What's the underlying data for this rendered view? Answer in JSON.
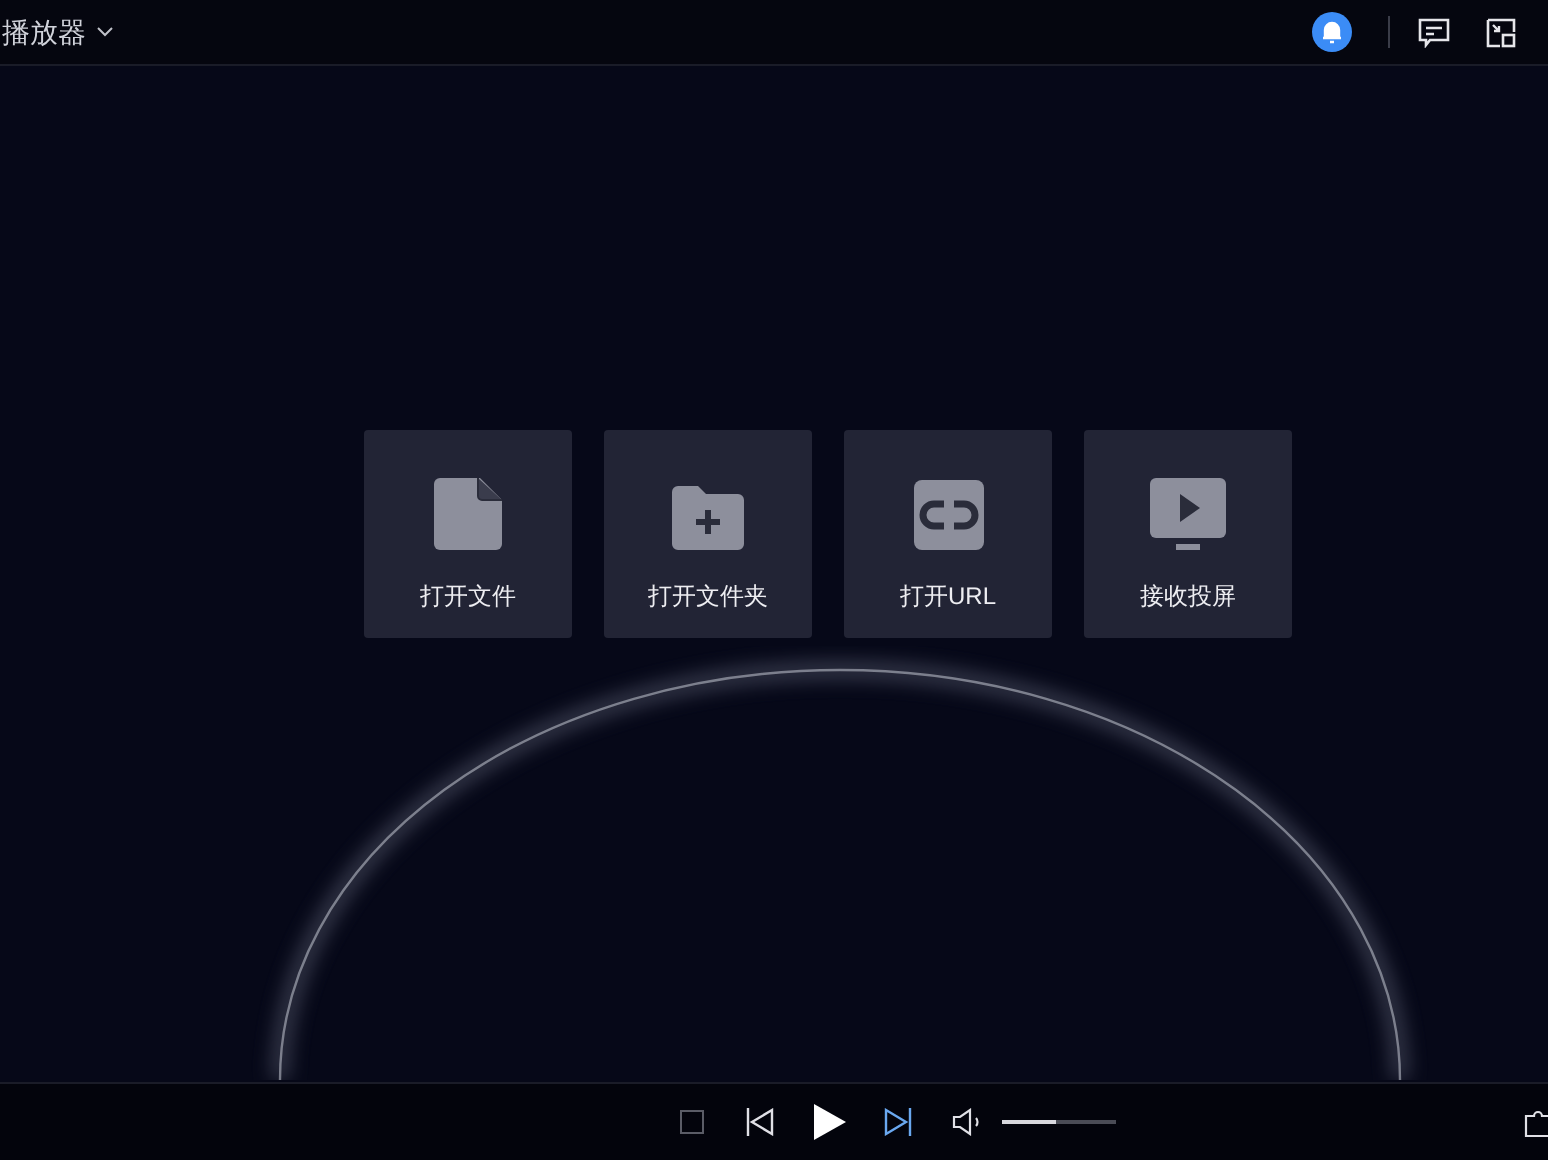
{
  "window": {
    "title": "播放器"
  },
  "actions": [
    {
      "kind": "file",
      "label": "打开文件"
    },
    {
      "kind": "folder",
      "label": "打开文件夹"
    },
    {
      "kind": "url",
      "label": "打开URL"
    },
    {
      "kind": "cast",
      "label": "接收投屏"
    }
  ],
  "controls": {
    "next_highlighted": true,
    "volume": {
      "level": 0.48
    }
  }
}
